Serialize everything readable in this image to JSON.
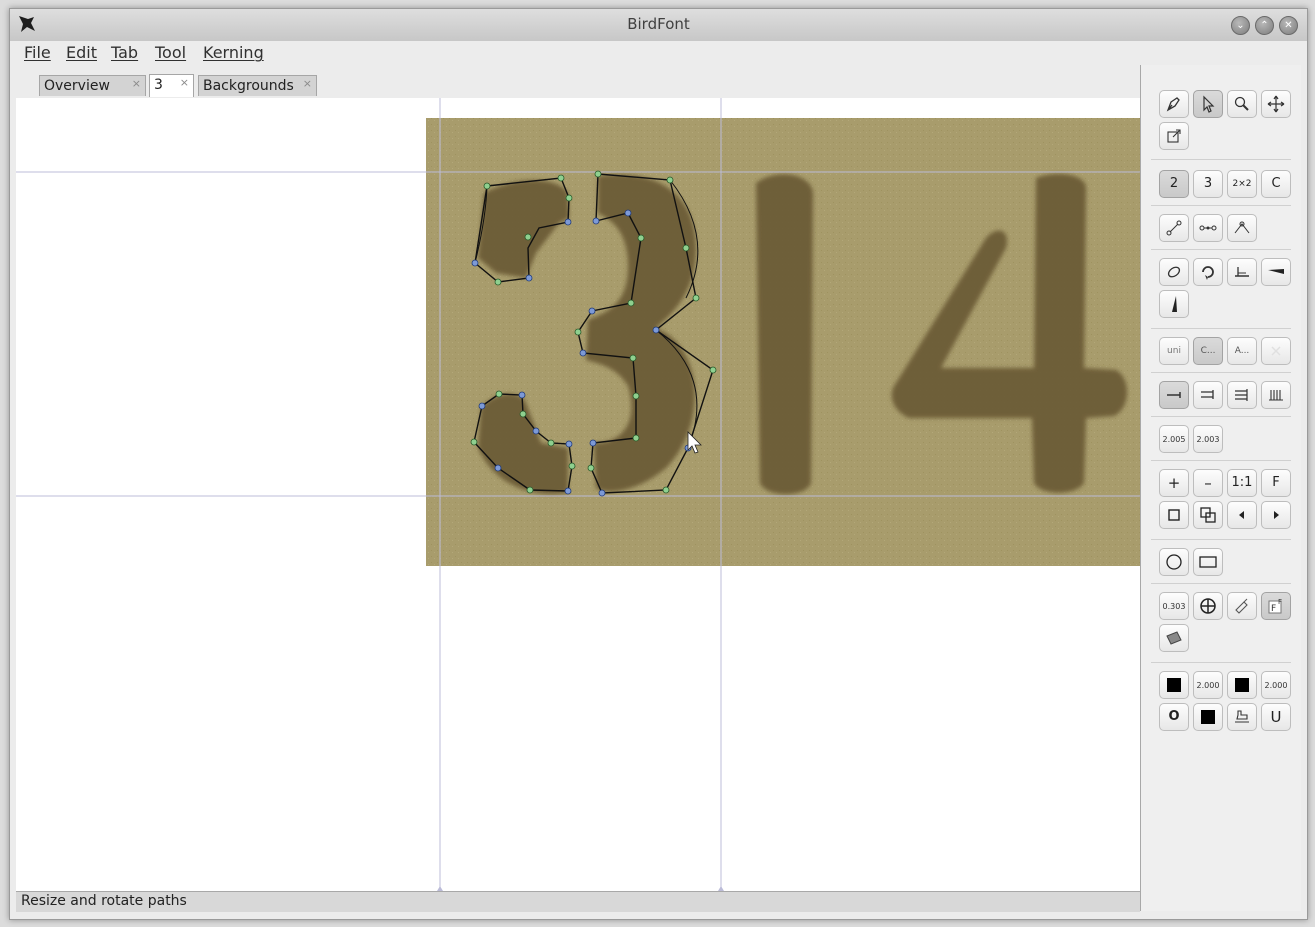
{
  "window": {
    "title": "BirdFont"
  },
  "menu": [
    "File",
    "Edit",
    "Tab",
    "Tool",
    "Kerning"
  ],
  "tabs": [
    {
      "label": "Overview",
      "active": false
    },
    {
      "label": "3",
      "active": true
    },
    {
      "label": "Backgrounds",
      "active": false
    }
  ],
  "toolbox": {
    "master_buttons": [
      "2",
      "3",
      "2×2",
      "C"
    ],
    "guide_buttons": [
      "uni",
      "C...",
      "A..."
    ],
    "stroke_values": [
      "2.005",
      "2.003"
    ],
    "zoom_buttons": [
      "+",
      "–",
      "1:1",
      "F"
    ],
    "background_scale": "0.303",
    "style_values": [
      "2.000",
      "2.000"
    ],
    "bottom_buttons": [
      "O",
      "U"
    ]
  },
  "status": {
    "text": "Resize and rotate paths"
  },
  "colors": {
    "background_image": "#a89c6c",
    "glyph_fill": "#6b5a36",
    "guide_lines": "#bcbcd8"
  },
  "icons": [
    "pen-tool-icon",
    "pointer-tool-icon",
    "zoom-tool-icon",
    "move-tool-icon",
    "close-path-icon"
  ]
}
